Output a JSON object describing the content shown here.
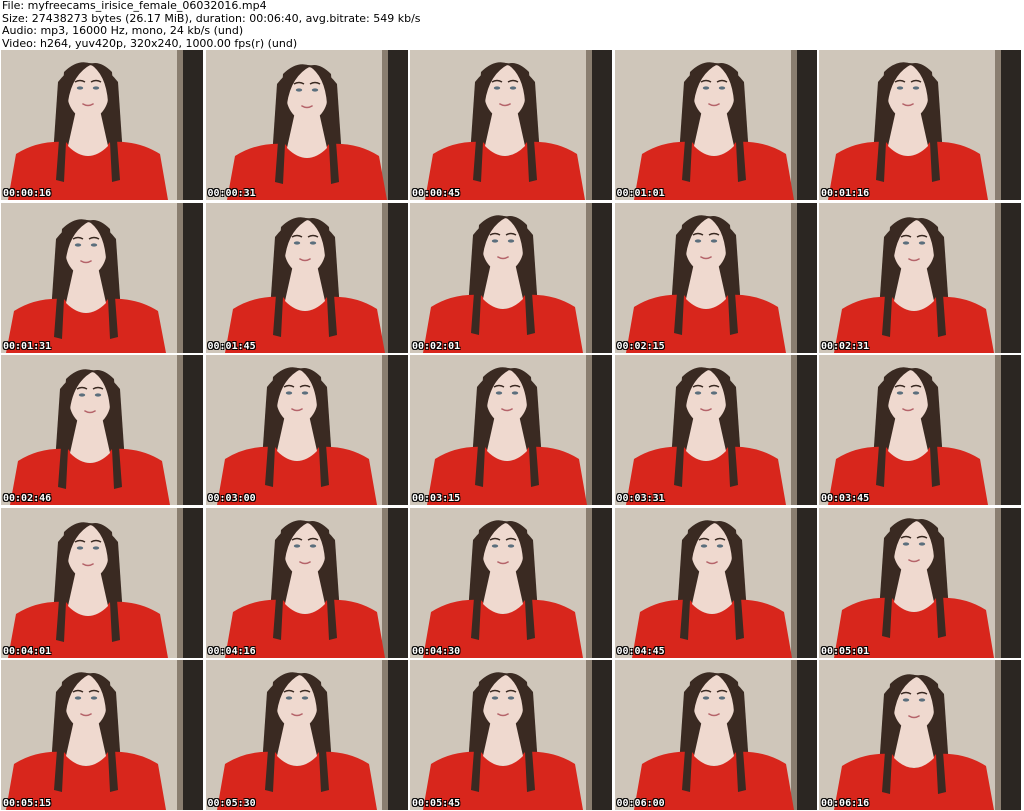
{
  "header": {
    "file_line": "File: myfreecams_irisice_female_06032016.mp4",
    "size_line": "Size: 27438273 bytes (26.17 MiB), duration: 00:06:40, avg.bitrate: 549 kb/s",
    "audio_line": "Audio: mp3, 16000 Hz, mono, 24 kb/s (und)",
    "video_line": "Video: h264, yuv420p, 320x240, 1000.00 fps(r) (und)"
  },
  "colors": {
    "shirt": "#d8261c",
    "hair": "#3a2a22",
    "skin": "#efd9cf",
    "wall": "#cfc6ba",
    "door": "#2b2622"
  },
  "frames": [
    {
      "time": "00:00:16"
    },
    {
      "time": "00:00:31"
    },
    {
      "time": "00:00:45"
    },
    {
      "time": "00:01:01"
    },
    {
      "time": "00:01:16"
    },
    {
      "time": "00:01:31"
    },
    {
      "time": "00:01:45"
    },
    {
      "time": "00:02:01"
    },
    {
      "time": "00:02:15"
    },
    {
      "time": "00:02:31"
    },
    {
      "time": "00:02:46"
    },
    {
      "time": "00:03:00"
    },
    {
      "time": "00:03:15"
    },
    {
      "time": "00:03:31"
    },
    {
      "time": "00:03:45"
    },
    {
      "time": "00:04:01"
    },
    {
      "time": "00:04:16"
    },
    {
      "time": "00:04:30"
    },
    {
      "time": "00:04:45"
    },
    {
      "time": "00:05:01"
    },
    {
      "time": "00:05:15"
    },
    {
      "time": "00:05:30"
    },
    {
      "time": "00:05:45"
    },
    {
      "time": "00:06:00"
    },
    {
      "time": "00:06:16"
    }
  ]
}
